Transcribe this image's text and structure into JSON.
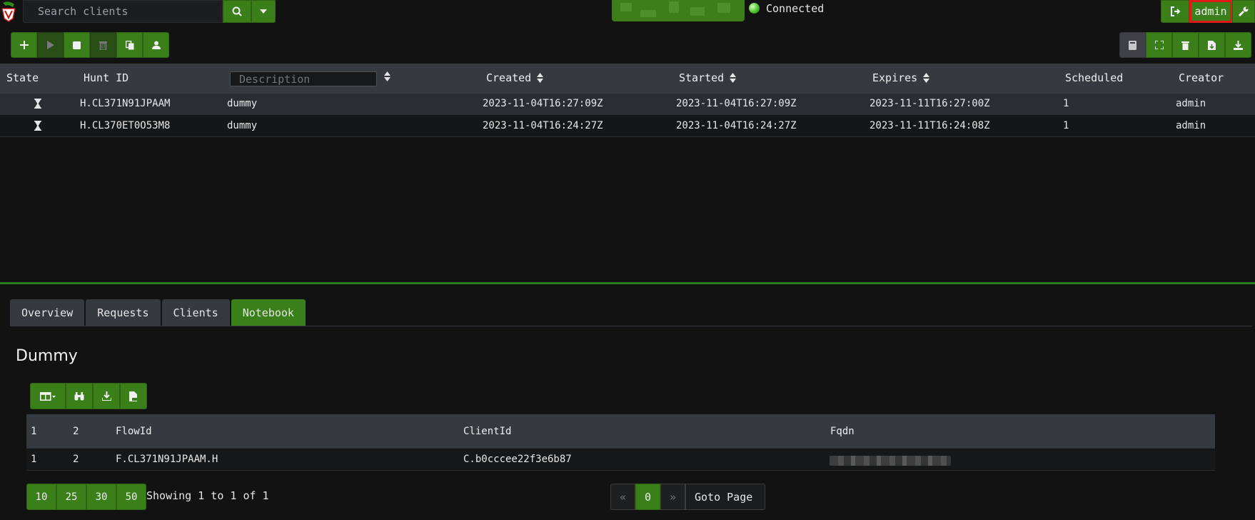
{
  "search": {
    "placeholder": "Search clients"
  },
  "status": {
    "text": "Connected"
  },
  "user": {
    "name": "admin"
  },
  "hunts": {
    "columns": {
      "state": "State",
      "hunt_id": "Hunt ID",
      "description": "Description",
      "created": "Created",
      "started": "Started",
      "expires": "Expires",
      "scheduled": "Scheduled",
      "creator": "Creator"
    },
    "rows": [
      {
        "hunt_id": "H.CL371N91JPAAM",
        "description": "dummy",
        "created": "2023-11-04T16:27:09Z",
        "started": "2023-11-04T16:27:09Z",
        "expires": "2023-11-11T16:27:00Z",
        "scheduled": "1",
        "creator": "admin"
      },
      {
        "hunt_id": "H.CL370ET0O53M8",
        "description": "dummy",
        "created": "2023-11-04T16:24:27Z",
        "started": "2023-11-04T16:24:27Z",
        "expires": "2023-11-11T16:24:08Z",
        "scheduled": "1",
        "creator": "admin"
      }
    ]
  },
  "tabs": [
    {
      "label": "Overview"
    },
    {
      "label": "Requests"
    },
    {
      "label": "Clients"
    },
    {
      "label": "Notebook"
    }
  ],
  "notebook": {
    "title": "Dummy",
    "columns": [
      "1",
      "2",
      "FlowId",
      "ClientId",
      "Fqdn"
    ],
    "rows": [
      {
        "c1": "1",
        "c2": "2",
        "flow_id": "F.CL371N91JPAAM.H",
        "client_id": "C.b0cccee22f3e6b87"
      }
    ]
  },
  "pagination": {
    "sizes": [
      "10",
      "25",
      "30",
      "50"
    ],
    "showing": "Showing 1 to 1 of 1",
    "prev": "«",
    "current_page": "0",
    "next": "»",
    "goto_placeholder": "Goto Page"
  },
  "colors": {
    "accent": "#3a7f1a",
    "header": "#343a40",
    "background": "#121212",
    "highlight": "#e01818"
  }
}
